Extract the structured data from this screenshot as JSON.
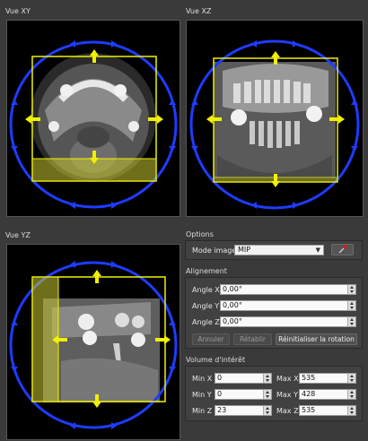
{
  "views": {
    "xy": {
      "title": "Vue XY"
    },
    "xz": {
      "title": "Vue XZ"
    },
    "yz": {
      "title": "Vue YZ"
    }
  },
  "options": {
    "title": "Options",
    "image_mode_label": "Mode image",
    "image_mode_value": "MIP",
    "picker_icon": "eyedropper-icon"
  },
  "alignment": {
    "title": "Alignement",
    "angle_x_label": "Angle X",
    "angle_x_value": "0,00°",
    "angle_y_label": "Angle Y",
    "angle_y_value": "0,00°",
    "angle_z_label": "Angle Z",
    "angle_z_value": "0,00°",
    "cancel_label": "Annuler",
    "redo_label": "Rétablir",
    "reset_label": "Réinitialiser la rotation"
  },
  "volume": {
    "title": "Volume d'intérêt",
    "min_x_label": "Min X",
    "min_x_value": "0",
    "max_x_label": "Max X",
    "max_x_value": "535",
    "min_y_label": "Min Y",
    "min_y_value": "0",
    "max_y_label": "Max Y",
    "max_y_value": "428",
    "min_z_label": "Min Z",
    "min_z_value": "23",
    "max_z_label": "Max Z",
    "max_z_value": "535"
  },
  "colors": {
    "circle": "#1e3cff",
    "roi": "#f0f000",
    "roi_fill": "#c8c832"
  }
}
